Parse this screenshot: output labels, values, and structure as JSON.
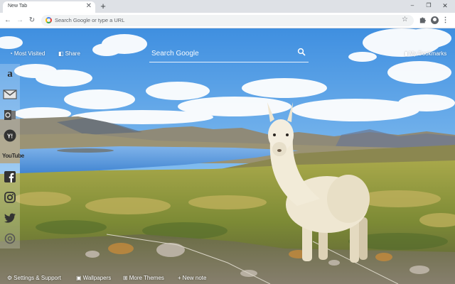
{
  "browser": {
    "tab_title": "New Tab",
    "tab_close": "✕",
    "new_tab": "+",
    "window_buttons": {
      "minimize": "‒",
      "maximize": "❐",
      "close": "✕"
    },
    "nav": {
      "back": "←",
      "forward": "→",
      "reload": "↻"
    },
    "omnibox_placeholder": "Search Google or type a URL",
    "star": "☆",
    "extensions_icon": "puzzle-icon",
    "profile_icon": "avatar-icon",
    "menu": "⋮"
  },
  "header": {
    "most_visited": "Most Visited",
    "most_visited_icon": "clock-icon",
    "share": "Share",
    "share_icon": "share-icon",
    "bookmarks": "My Bookmarks",
    "bookmarks_icon": "bookmark-icon"
  },
  "search": {
    "placeholder": "Search Google",
    "icon": "search-icon"
  },
  "sidebar": {
    "items": [
      {
        "name": "amazon",
        "glyph": "a"
      },
      {
        "name": "gmail",
        "glyph": ""
      },
      {
        "name": "outlook",
        "glyph": "o"
      },
      {
        "name": "yahoo",
        "glyph": "Y!"
      },
      {
        "name": "youtube",
        "glyph": "YouTube"
      },
      {
        "name": "facebook",
        "glyph": "f"
      },
      {
        "name": "instagram",
        "glyph": ""
      },
      {
        "name": "twitter",
        "glyph": ""
      },
      {
        "name": "more",
        "glyph": ""
      }
    ]
  },
  "footer": {
    "settings": "Settings & Support",
    "wallpapers": "Wallpapers",
    "more_themes": "More Themes",
    "new_note": "New note",
    "new_note_prefix": "+"
  },
  "colors": {
    "chrome_bg": "#dee1e6",
    "sky": "#4f9ee3",
    "lake": "#4a8fd6",
    "grass": "#8a8a3a",
    "text": "#ffffff"
  }
}
